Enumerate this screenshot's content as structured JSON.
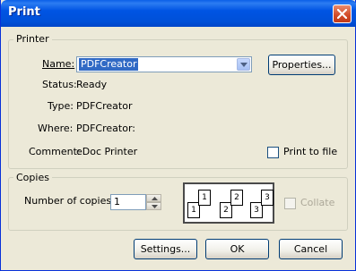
{
  "window": {
    "title": "Print"
  },
  "printer": {
    "legend": "Printer",
    "name_label": "Name:",
    "name_value": "PDFCreator",
    "properties_button": "Properties...",
    "status_label": "Status:",
    "status_value": "Ready",
    "type_label": "Type:",
    "type_value": "PDFCreator",
    "where_label": "Where:",
    "where_value": "PDFCreator:",
    "comment_label": "Comment:",
    "comment_value": "eDoc Printer",
    "print_to_file_label": "Print to file",
    "print_to_file_checked": false
  },
  "copies": {
    "legend": "Copies",
    "number_label": "Number of copies:",
    "number_value": "1",
    "collate_label": "Collate",
    "collate_checked": false,
    "collate_pages": [
      "1",
      "1",
      "2",
      "2",
      "3",
      "3"
    ]
  },
  "buttons": {
    "settings": "Settings...",
    "ok": "OK",
    "cancel": "Cancel"
  },
  "colors": {
    "titlebar": "#0054e3",
    "dialog_bg": "#ece9d8",
    "selection": "#316ac5",
    "close_button": "#d14a26"
  },
  "icons": [
    "close-icon",
    "dropdown-arrow-icon",
    "spin-up-icon",
    "spin-down-icon",
    "collate-pages-icon"
  ]
}
